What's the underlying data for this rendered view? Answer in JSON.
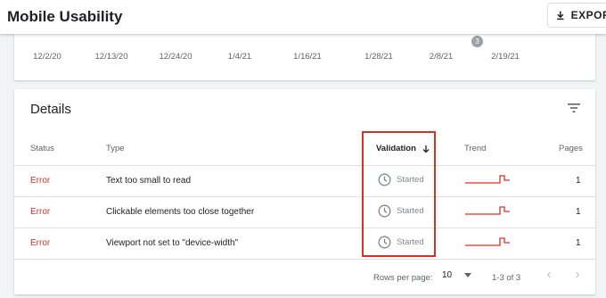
{
  "app": {
    "title": "Mobile Usability"
  },
  "toolbar": {
    "export_label": "EXPORT"
  },
  "chart_data": {
    "type": "line",
    "x_ticks": [
      "12/2/20",
      "12/13/20",
      "12/24/20",
      "1/4/21",
      "1/16/21",
      "1/28/21",
      "2/8/21",
      "2/19/21"
    ],
    "annotations": [
      {
        "label": "3",
        "x": "2/14/21"
      }
    ]
  },
  "details": {
    "title": "Details",
    "columns": {
      "status": "Status",
      "type": "Type",
      "validation": "Validation",
      "trend": "Trend",
      "pages": "Pages"
    },
    "rows": [
      {
        "status": "Error",
        "type": "Text too small to read",
        "validation": "Started",
        "pages": "1"
      },
      {
        "status": "Error",
        "type": "Clickable elements too close together",
        "validation": "Started",
        "pages": "1"
      },
      {
        "status": "Error",
        "type": "Viewport not set to \"device-width\"",
        "validation": "Started",
        "pages": "1"
      }
    ]
  },
  "pagination": {
    "rows_per_page_label": "Rows per page:",
    "rows_per_page": "10",
    "range": "1-3 of 3",
    "prev": "‹",
    "next": "›"
  },
  "colors": {
    "error": "#d93025",
    "highlight": "#d93025"
  }
}
